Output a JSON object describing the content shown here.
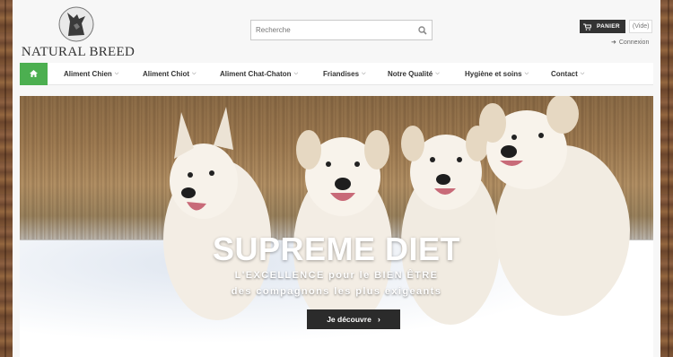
{
  "header": {
    "logo_text": "NATURAL BREED",
    "search_placeholder": "Recherche",
    "cart_label": "PANIER",
    "cart_status": "(Vide)",
    "login_label": "Connexion"
  },
  "nav": {
    "items": [
      {
        "label": "Aliment Chien"
      },
      {
        "label": "Aliment Chiot"
      },
      {
        "label": "Aliment Chat-Chaton"
      },
      {
        "label": "Friandises"
      },
      {
        "label": "Notre Qualité"
      },
      {
        "label": "Hygiène et soins"
      },
      {
        "label": "Contact"
      }
    ]
  },
  "hero": {
    "title": "SUPREME DIET",
    "subtitle_line1": "L'EXCELLENCE pour le BIEN ÊTRE",
    "subtitle_line2": "des compagnons les plus exigeants",
    "button_label": "Je découvre"
  },
  "colors": {
    "nav_home_bg": "#4caf50",
    "button_bg": "#2b2b2b",
    "cart_bg": "#333333"
  }
}
